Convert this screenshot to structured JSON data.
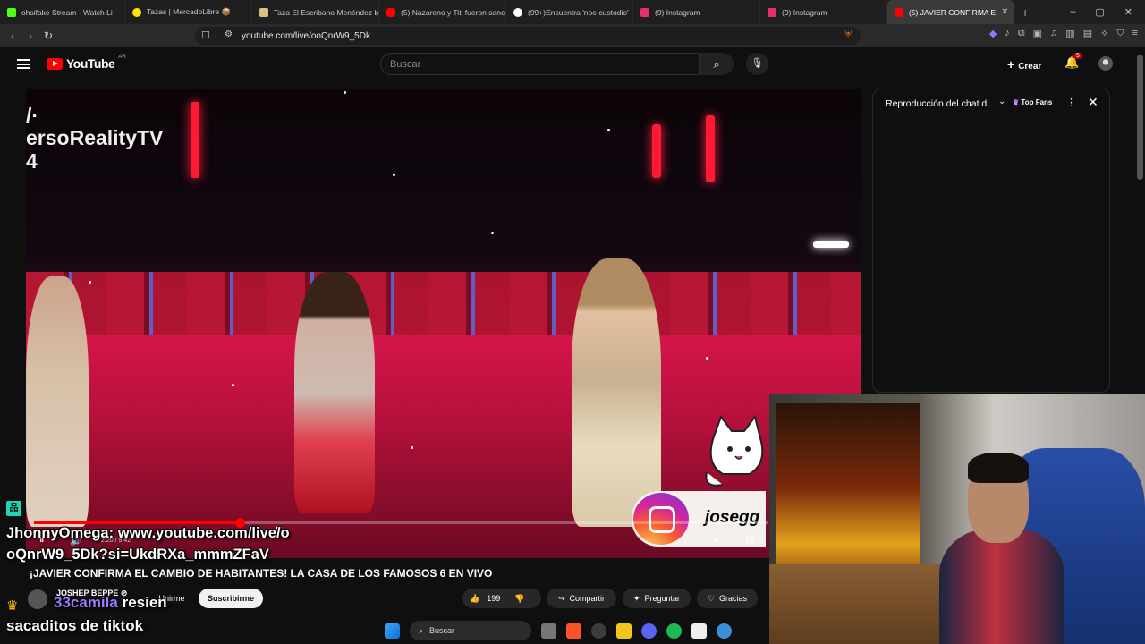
{
  "tabs": [
    {
      "title": "ohsifake Stream - Watch Li",
      "color": "#53fc18"
    },
    {
      "title": "Tazas | MercadoLibre 📦",
      "color": "#ffe600"
    },
    {
      "title": "Taza El Escribano Menéndez by",
      "color": "#e0c080"
    },
    {
      "title": "(5) Nazareno y Titi fueron sanc",
      "color": "#ff0000"
    },
    {
      "title": "(99+)Encuentra 'noe custodio'",
      "color": "#ffffff"
    },
    {
      "title": "(9) Instagram",
      "color": "#e1306c"
    },
    {
      "title": "(9) Instagram",
      "color": "#e1306c"
    },
    {
      "title": "(5) JAVIER CONFIRMA E",
      "color": "#ff0000"
    }
  ],
  "browser": {
    "url": "youtube.com/live/ooQnrW9_5Dk",
    "new_tab": "+",
    "min": "–",
    "max": "▢",
    "close": "✕"
  },
  "youtube": {
    "brand": "YouTube",
    "country": "AR",
    "search_placeholder": "Buscar",
    "create_label": "Crear",
    "notif_count": "5"
  },
  "video": {
    "watermark_line1": "/·",
    "watermark_line2": "ersoRealityTV",
    "watermark_line3": "4",
    "time": "2:20 / 9:42",
    "progress_fraction": 0.28,
    "instagram_handle": "josegg"
  },
  "chat_panel": {
    "title": "Reproducción del chat d...",
    "badge": "Top Fans"
  },
  "stream_title": "¡JAVIER CONFIRMA EL CAMBIO DE HABITANTES! LA CASA DE LOS FAMOSOS 6 EN VIVO",
  "channel": {
    "name": "JOSHEP BEPPE ⊘",
    "join": "Unirme",
    "subscribe": "Suscribirme"
  },
  "actions": {
    "likes": "199",
    "share": "Compartir",
    "ask": "Preguntar",
    "thanks": "Gracias"
  },
  "overlay_chat": {
    "user1": "JhonnyOmega:",
    "msg1": "www.youtube.com/live/ooQnrW9_5Dk?si=UkdRXa_mmmZFaV",
    "user2": "33camila",
    "msg2": "resien",
    "msg3": "sacaditos de tiktok"
  },
  "taskbar": {
    "search": "Buscar"
  }
}
